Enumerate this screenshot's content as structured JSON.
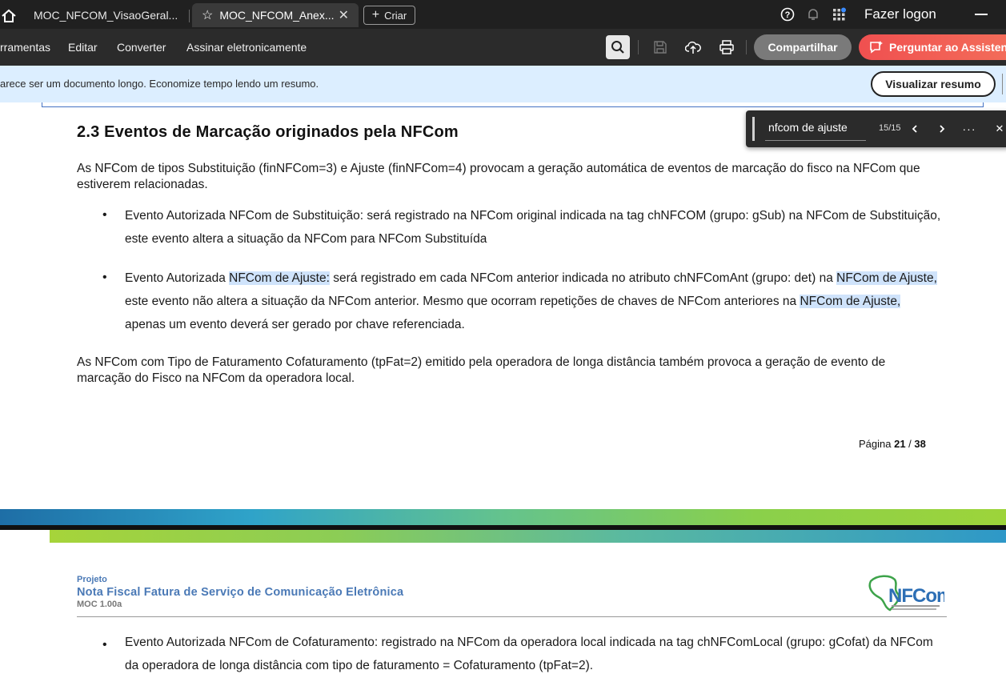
{
  "tabs": {
    "tab1_title": "MOC_NFCOM_VisaoGeral...",
    "tab2_title": "MOC_NFCOM_Anex...",
    "new_label": "Criar"
  },
  "header": {
    "signin": "Fazer logon"
  },
  "toolbar": {
    "menu": [
      "rramentas",
      "Editar",
      "Converter",
      "Assinar eletronicamente"
    ],
    "share_label": "Compartilhar",
    "ask_label": "Perguntar ao Assistente"
  },
  "notice": {
    "text": "arece ser um documento longo. Economize tempo lendo um resumo.",
    "button": "Visualizar resumo"
  },
  "find": {
    "query": "nfcom de ajuste",
    "count": "15/15"
  },
  "document": {
    "heading": "2.3  Eventos de Marcação originados pela NFCom",
    "para1": "As NFCom de tipos Substituição (finNFCom=3) e Ajuste (finNFCom=4) provocam a geração automática de eventos de marcação do fisco na NFCom que estiverem relacionadas.",
    "bullet1": "Evento Autorizada NFCom de Substituição: será registrado na NFCom original indicada na tag chNFCOM (grupo: gSub) na NFCom de Substituição, este evento altera a situação da NFCom para NFCom Substituída",
    "bullet2": {
      "p1": "Evento Autorizada ",
      "h1": "NFCom de Ajuste:",
      "p2": " será registrado em cada NFCom anterior indicada no atributo chNFComAnt (grupo: det) na ",
      "h2": "NFCom de Ajuste,",
      "p3": " este evento não altera a situação da NFCom anterior. Mesmo que ocorram repetições de chaves de NFCom anteriores na ",
      "h3": "NFCom de Ajuste,",
      "p4": " apenas um evento deverá ser gerado por chave referenciada."
    },
    "para2": "As NFCom com Tipo de Faturamento Cofaturamento (tpFat=2) emitido pela operadora de longa distância também provoca a geração de evento de marcação do Fisco na NFCom da operadora local.",
    "page_prefix": "Página ",
    "page_current": "21",
    "page_sep": " / ",
    "page_total": "38",
    "project_label": "Projeto",
    "project_title": "Nota Fiscal Fatura de Serviço de Comunicação Eletrônica",
    "project_version": "MOC 1.00a",
    "logo_text": "NFCom",
    "bullet3": "Evento Autorizada NFCom de Cofaturamento: registrado na NFCom da operadora local indicada na tag chNFComLocal (grupo: gCofat) da NFCom da operadora de longa distância com tipo de faturamento = Cofaturamento (tpFat=2)."
  }
}
